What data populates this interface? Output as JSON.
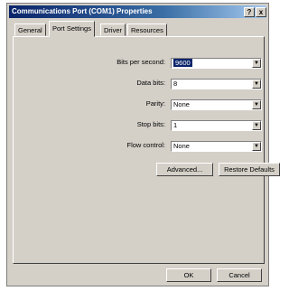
{
  "window": {
    "title": "Communications Port (COM1) Properties"
  },
  "titlebar_buttons": {
    "help": "?",
    "close": "x"
  },
  "tabs": [
    {
      "label": "General"
    },
    {
      "label": "Port Settings"
    },
    {
      "label": "Driver"
    },
    {
      "label": "Resources"
    }
  ],
  "settings": {
    "bits_per_second": {
      "label": "Bits per second:",
      "value": "9600"
    },
    "data_bits": {
      "label": "Data bits:",
      "value": "8"
    },
    "parity": {
      "label": "Parity:",
      "value": "None"
    },
    "stop_bits": {
      "label": "Stop bits:",
      "value": "1"
    },
    "flow_control": {
      "label": "Flow control:",
      "value": "None"
    }
  },
  "buttons": {
    "advanced": "Advanced...",
    "restore_defaults": "Restore Defaults",
    "ok": "OK",
    "cancel": "Cancel"
  },
  "icons": {
    "dropdown": "chevron-down-icon"
  }
}
